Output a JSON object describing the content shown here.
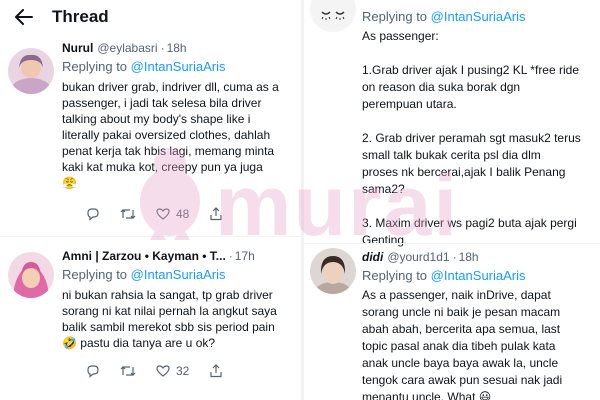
{
  "left": {
    "title": "Thread",
    "tweets": [
      {
        "author": "Nurul",
        "handle": "@eylabasri",
        "time": "18h",
        "reply_prefix": "Replying to ",
        "reply_to": "@IntanSuriaAris",
        "lines": [
          "bukan driver grab, indriver dll, cuma as a",
          "passenger, i jadi tak selesa bila driver",
          "talking about my body's shape like i",
          "literally pakai oversized clothes, dahlah",
          "penat kerja tak hbis lagi, memang minta",
          "kaki kat muka kot, creepy pun ya juga",
          "😤"
        ],
        "like_count": "48"
      },
      {
        "author": "Amni | Zarzou • Kayman • T...",
        "time": "17h",
        "reply_prefix": "Replying to ",
        "reply_to": "@IntanSuriaAris",
        "lines": [
          "ni bukan rahsia la sangat, tp grab driver",
          "sorang ni kat nilai pernah la angkut saya",
          "balik sambil merekot sbb sis period pain",
          "🤣 pastu dia tanya are u ok?"
        ],
        "like_count": "32"
      }
    ]
  },
  "right": {
    "top_reply_prefix": "Replying to ",
    "top_reply_to": "@IntanSuriaAris",
    "top_lines": [
      "As passenger:",
      "",
      "1.Grab driver ajak I pusing2 KL *free ride",
      "on reason dia suka borak dgn",
      "perempuan utara.",
      "",
      "2. Grab driver peramah sgt masuk2 terus",
      "small talk bukak cerita psl dia dlm",
      "proses nk bercerai,ajak I balik Penang",
      "sama2?",
      "",
      "3. Maxim driver ws pagi2 buta ajak pergi",
      "Genting."
    ],
    "second": {
      "author": "didi",
      "handle": "@yourd1d1",
      "time": "18h",
      "reply_prefix": "Replying to ",
      "reply_to": "@IntanSuriaAris",
      "lines": [
        "As a passenger, naik inDrive, dapat",
        "sorang uncle ni baik je pesan macam",
        "abah abah, bercerita apa semua, last",
        "topic pasal anak dia tibeh pulak kata",
        "anak uncle baya baya awak la, uncle",
        "tengok cara awak pun sesuai nak jadi",
        "menantu uncle. What 😃"
      ]
    }
  },
  "watermark_text": "murai",
  "colors": {
    "link": "#1d9bf0",
    "muted": "#536471",
    "watermark": "#e8a0c8"
  }
}
